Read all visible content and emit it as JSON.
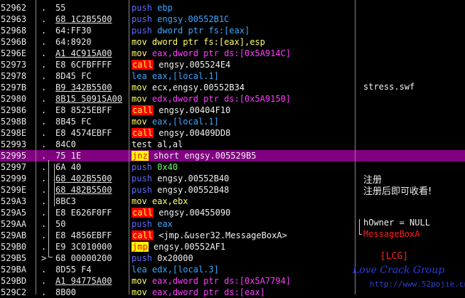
{
  "rows": [
    {
      "addr": "52962",
      "dot": ".",
      "hex": "55",
      "ul": false,
      "op": "push",
      "opc": "blue",
      "arg": "ebp",
      "argc": "cyan"
    },
    {
      "addr": "52963",
      "dot": ".",
      "hex": "68 1C2B5500",
      "ul": true,
      "op": "push",
      "opc": "blue",
      "arg": "engsy.00552B1C",
      "argc": "cyan"
    },
    {
      "addr": "52968",
      "dot": ".",
      "hex": "64:FF30",
      "ul": false,
      "op": "push",
      "opc": "blue",
      "arg": "dword ptr fs:[eax]",
      "argc": "cyan"
    },
    {
      "addr": "5296B",
      "dot": ".",
      "hex": "64:8920",
      "ul": false,
      "op": "mov",
      "opc": "yel",
      "arg": "dword ptr fs:[eax],esp",
      "argc": "yel"
    },
    {
      "addr": "5296E",
      "dot": ".",
      "hex": "A1 4C915A00",
      "ul": true,
      "op": "mov",
      "opc": "yel",
      "arg": "eax,dword ptr ds:[0x5A914C]",
      "argc": "mag"
    },
    {
      "addr": "52973",
      "dot": ".",
      "hex": "E8 6CFBFFFF",
      "ul": false,
      "op": "call",
      "opc": "call",
      "arg": "engsy.005524E4",
      "argc": "white"
    },
    {
      "addr": "52978",
      "dot": ".",
      "hex": "8D45 FC",
      "ul": false,
      "op": "lea",
      "opc": "cyan",
      "arg": "eax,[local.1]",
      "argc": "cyan"
    },
    {
      "addr": "5297B",
      "dot": ".",
      "hex": "B9 342B5500",
      "ul": true,
      "op": "mov",
      "opc": "yel",
      "arg": "ecx,engsy.00552B34",
      "argc": "white"
    },
    {
      "addr": "52980",
      "dot": ".",
      "hex": "8B15 50915A00",
      "ul": true,
      "op": "mov",
      "opc": "yel",
      "arg": "edx,dword ptr ds:[0x5A9150]",
      "argc": "mag"
    },
    {
      "addr": "52986",
      "dot": ".",
      "hex": "E8 8525EBFF",
      "ul": false,
      "op": "call",
      "opc": "call",
      "arg": "engsy.00404F10",
      "argc": "white"
    },
    {
      "addr": "5298B",
      "dot": ".",
      "hex": "8B45 FC",
      "ul": false,
      "op": "mov",
      "opc": "yel",
      "arg": "eax,[local.1]",
      "argc": "cyan"
    },
    {
      "addr": "5298E",
      "dot": ".",
      "hex": "E8 4574EBFF",
      "ul": false,
      "op": "call",
      "opc": "call",
      "arg": "engsy.00409DD8",
      "argc": "white"
    },
    {
      "addr": "52993",
      "dot": ".",
      "hex": "84C0",
      "ul": false,
      "op": "test",
      "opc": "white",
      "arg": "al,al",
      "argc": "white"
    },
    {
      "addr": "52995",
      "dot": ".",
      "hex": "75 1E",
      "ul": false,
      "op": "jnz",
      "opc": "jmp",
      "arg": "short engsy.005529B5",
      "argc": "white",
      "selected": true
    },
    {
      "addr": "52997",
      "dot": ".",
      "hex": "6A 40",
      "ul": false,
      "op": "push",
      "opc": "blue",
      "arg": "0x40",
      "argc": "grn"
    },
    {
      "addr": "52999",
      "dot": ".",
      "hex": "68 402B5500",
      "ul": true,
      "op": "push",
      "opc": "blue",
      "arg": "engsy.00552B40",
      "argc": "white"
    },
    {
      "addr": "5299E",
      "dot": ".",
      "hex": "68 482B5500",
      "ul": true,
      "op": "push",
      "opc": "blue",
      "arg": "engsy.00552B48",
      "argc": "white"
    },
    {
      "addr": "529A3",
      "dot": ".",
      "hex": "8BC3",
      "ul": false,
      "op": "mov",
      "opc": "yel",
      "arg": "eax,ebx",
      "argc": "yel"
    },
    {
      "addr": "529A5",
      "dot": ".",
      "hex": "E8 E626F0FF",
      "ul": false,
      "op": "call",
      "opc": "call",
      "arg": "engsy.00455090",
      "argc": "white"
    },
    {
      "addr": "529AA",
      "dot": ".",
      "hex": "50",
      "ul": false,
      "op": "push",
      "opc": "blue",
      "arg": "eax",
      "argc": "cyan"
    },
    {
      "addr": "529AB",
      "dot": ".",
      "hex": "E8 4856EBFF",
      "ul": false,
      "op": "call",
      "opc": "call",
      "arg": "<jmp.&user32.MessageBoxA>",
      "argc": "white"
    },
    {
      "addr": "529B0",
      "dot": ".",
      "hex": "E9 3C010000",
      "ul": false,
      "op": "jmp",
      "opc": "jmp",
      "arg": "engsy.00552AF1",
      "argc": "white"
    },
    {
      "addr": "529B5",
      "dot": ">",
      "hex": "68 00000200",
      "ul": false,
      "op": "push",
      "opc": "blue",
      "arg": "0x20000",
      "argc": "white"
    },
    {
      "addr": "529BA",
      "dot": ".",
      "hex": "8D55 F4",
      "ul": false,
      "op": "lea",
      "opc": "cyan",
      "arg": "edx,[local.3]",
      "argc": "cyan"
    },
    {
      "addr": "529BD",
      "dot": ".",
      "hex": "A1 94775A00",
      "ul": true,
      "op": "mov",
      "opc": "yel",
      "arg": "eax,dword ptr ds:[0x5A7794]",
      "argc": "mag"
    },
    {
      "addr": "529C2",
      "dot": ".",
      "hex": "8B00",
      "ul": false,
      "op": "mov",
      "opc": "yel",
      "arg": "eax,dword ptr ds:[eax]",
      "argc": "mag"
    }
  ],
  "comments": {
    "stress": "stress.swf",
    "zhuce": "注册",
    "zhuce_msg": "注册后即可收看!",
    "howner": "hOwner = NULL",
    "msgbox": "MessageBoxA",
    "lcg": "[LCG]",
    "lcg_name": "Love Crack Group",
    "site": "http://www.52pojie.cn"
  },
  "colors": {
    "selection": "#800080",
    "call_bg": "#ff0000",
    "jmp_bg": "#ffff00",
    "watermark": "#2f3fd8"
  }
}
